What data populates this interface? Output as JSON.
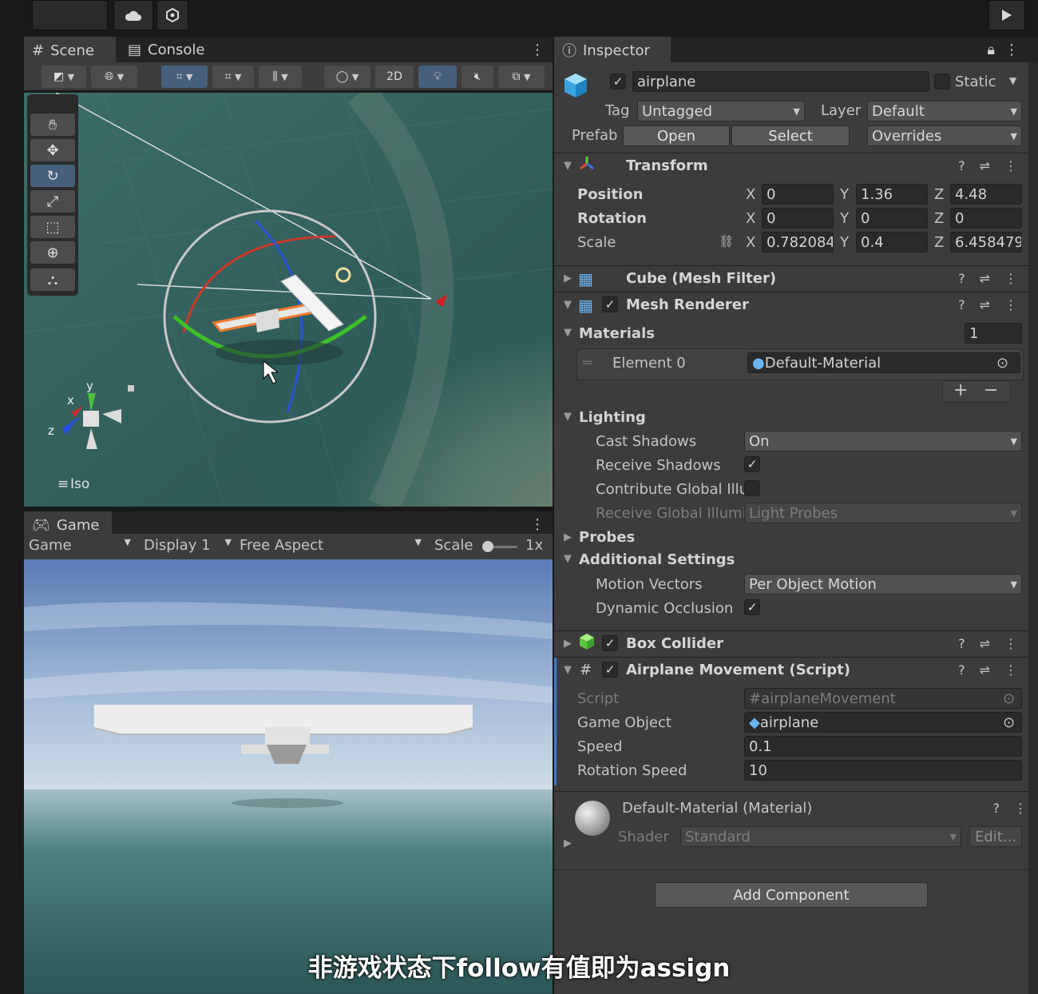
{
  "toolbar": {
    "play_icon": "play-icon"
  },
  "scene_tabs": {
    "scene": "Scene",
    "console": "Console"
  },
  "scene_tools": {
    "mode_2d": "2D"
  },
  "gizmo": {
    "x": "x",
    "y": "y",
    "z": "z",
    "projection": "Iso"
  },
  "game_panel": {
    "tab": "Game",
    "view_mode": "Game",
    "display": "Display 1",
    "aspect": "Free Aspect",
    "scale_label": "Scale",
    "scale_value": "1x"
  },
  "inspector": {
    "tab": "Inspector",
    "object_name": "airplane",
    "static_label": "Static",
    "tag_label": "Tag",
    "tag_value": "Untagged",
    "layer_label": "Layer",
    "layer_value": "Default",
    "prefab_label": "Prefab",
    "open_label": "Open",
    "select_label": "Select",
    "overrides_label": "Overrides",
    "transform": {
      "title": "Transform",
      "position_label": "Position",
      "rotation_label": "Rotation",
      "scale_label": "Scale",
      "x_label": "X",
      "y_label": "Y",
      "z_label": "Z",
      "position": {
        "x": "0",
        "y": "1.36",
        "z": "4.48"
      },
      "rotation": {
        "x": "0",
        "y": "0",
        "z": "0"
      },
      "scale": {
        "x": "0.782084",
        "y": "0.4",
        "z": "6.458479"
      }
    },
    "mesh_filter": {
      "title": "Cube (Mesh Filter)"
    },
    "mesh_renderer": {
      "title": "Mesh Renderer",
      "materials_label": "Materials",
      "materials_count": "1",
      "element0_label": "Element 0",
      "element0_value": "Default-Material",
      "plus": "+",
      "minus": "−",
      "lighting_label": "Lighting",
      "cast_shadows_label": "Cast Shadows",
      "cast_shadows_value": "On",
      "receive_shadows_label": "Receive Shadows",
      "contribute_gi_label": "Contribute Global Illu",
      "receive_gi_label": "Receive Global Illumi",
      "receive_gi_value": "Light Probes",
      "probes_label": "Probes",
      "additional_label": "Additional Settings",
      "motion_vectors_label": "Motion Vectors",
      "motion_vectors_value": "Per Object Motion",
      "dynamic_occlusion_label": "Dynamic Occlusion"
    },
    "box_collider": {
      "title": "Box Collider"
    },
    "script_comp": {
      "title": "Airplane Movement (Script)",
      "script_label": "Script",
      "script_value": "airplaneMovement",
      "game_object_label": "Game Object",
      "game_object_value": "airplane",
      "speed_label": "Speed",
      "speed_value": "0.1",
      "rotation_speed_label": "Rotation Speed",
      "rotation_speed_value": "10"
    },
    "material": {
      "title": "Default-Material (Material)",
      "shader_label": "Shader",
      "shader_value": "Standard",
      "edit_label": "Edit..."
    },
    "add_component": "Add Component"
  },
  "subtitle": "非游戏状态下follow有值即为assign"
}
